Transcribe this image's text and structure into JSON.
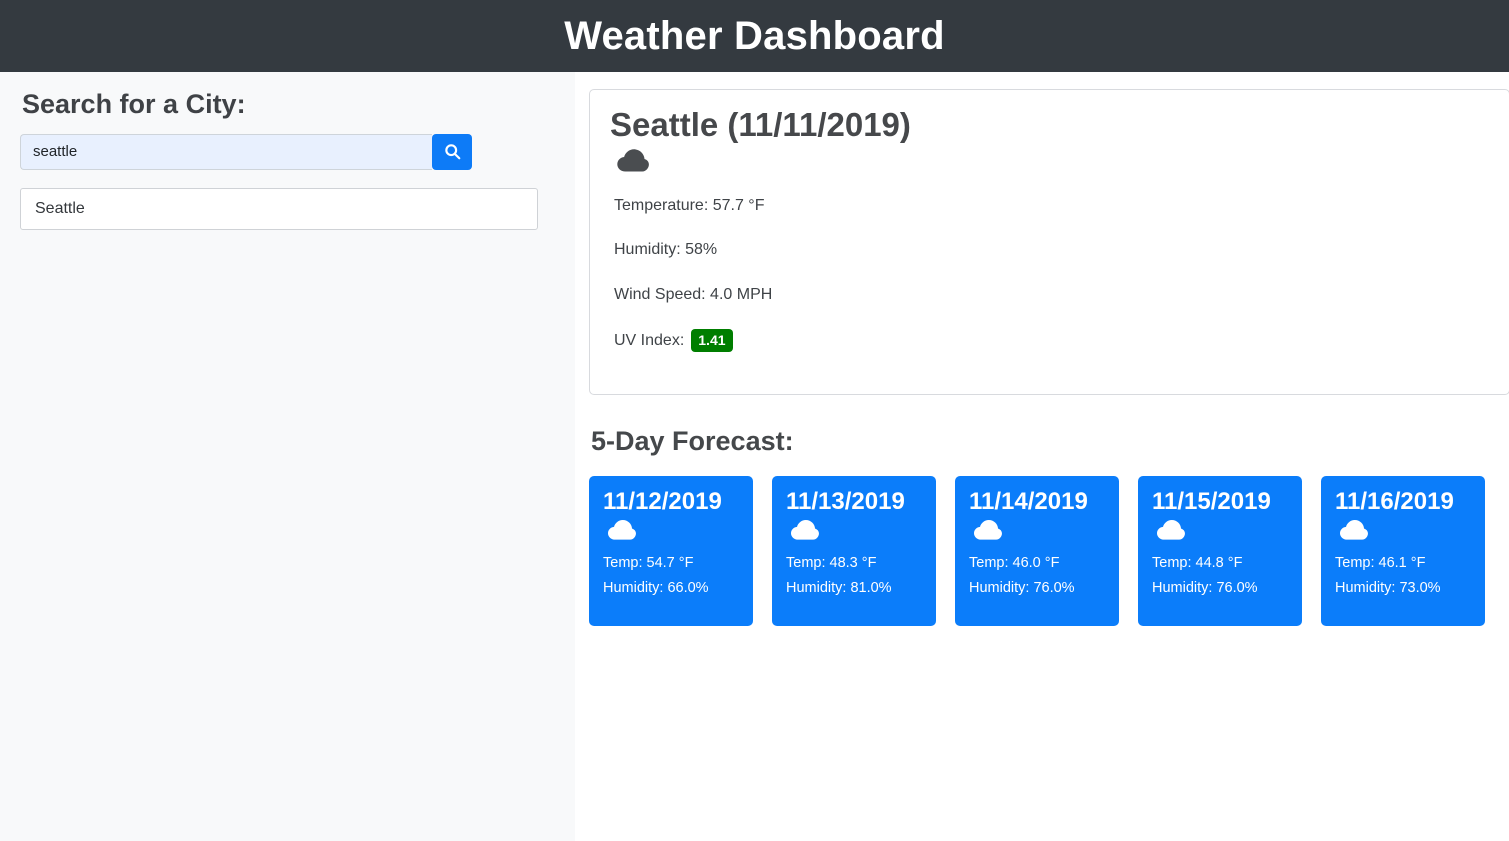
{
  "header": {
    "title": "Weather Dashboard",
    "background_color": "#343a40"
  },
  "sidebar": {
    "heading": "Search for a City:",
    "search": {
      "value": "seattle",
      "placeholder": "",
      "button_icon": "search-icon",
      "button_color": "#0d7bf7"
    },
    "cities": [
      {
        "label": "Seattle"
      }
    ]
  },
  "today": {
    "title": "Seattle (11/11/2019)",
    "icon": "cloud-icon",
    "temperature": "Temperature: 57.7 °F",
    "humidity": "Humidity: 58%",
    "wind": "Wind Speed: 4.0 MPH",
    "uv_label": "UV Index:",
    "uv_value": "1.41",
    "uv_badge_color": "#007e00"
  },
  "forecast": {
    "heading": "5-Day Forecast:",
    "card_color": "#0b7dfa",
    "days": [
      {
        "date": "11/12/2019",
        "icon": "cloud-icon",
        "temp": "Temp: 54.7 °F",
        "humidity": "Humidity: 66.0%"
      },
      {
        "date": "11/13/2019",
        "icon": "cloud-icon",
        "temp": "Temp: 48.3 °F",
        "humidity": "Humidity: 81.0%"
      },
      {
        "date": "11/14/2019",
        "icon": "cloud-icon",
        "temp": "Temp: 46.0 °F",
        "humidity": "Humidity: 76.0%"
      },
      {
        "date": "11/15/2019",
        "icon": "cloud-icon",
        "temp": "Temp: 44.8 °F",
        "humidity": "Humidity: 76.0%"
      },
      {
        "date": "11/16/2019",
        "icon": "cloud-icon",
        "temp": "Temp: 46.1 °F",
        "humidity": "Humidity: 73.0%"
      }
    ]
  }
}
